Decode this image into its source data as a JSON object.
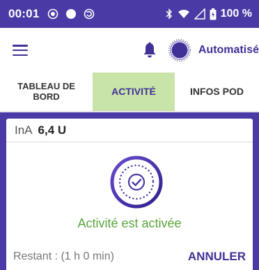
{
  "status_bar": {
    "time": "00:01",
    "battery": "100 %",
    "icons": [
      "radio-icon",
      "circle-icon",
      "sync-icon",
      "bluetooth-icon",
      "wifi-icon",
      "signal-icon",
      "battery-icon"
    ]
  },
  "header": {
    "menu_icon": "hamburger-icon",
    "bell_icon": "bell-icon",
    "pod_icon": "pod-status-icon",
    "mode_label": "Automatisé"
  },
  "tabs": [
    {
      "label": "TABLEAU DE BORD",
      "active": false
    },
    {
      "label": "ACTIVITÉ",
      "active": true
    },
    {
      "label": "INFOS POD",
      "active": false
    }
  ],
  "card": {
    "iob_label": "InA",
    "iob_value": "6,4 U",
    "activity_icon": "activity-check-icon",
    "status_text": "Activité est activée",
    "remaining_text": "Restant : (1 h 0 min)",
    "cancel_label": "ANNULER"
  },
  "colors": {
    "primary": "#4a3aa6",
    "accent_text": "#3f3196",
    "active_tab": "#c9e4a8",
    "success": "#5aa63a"
  }
}
